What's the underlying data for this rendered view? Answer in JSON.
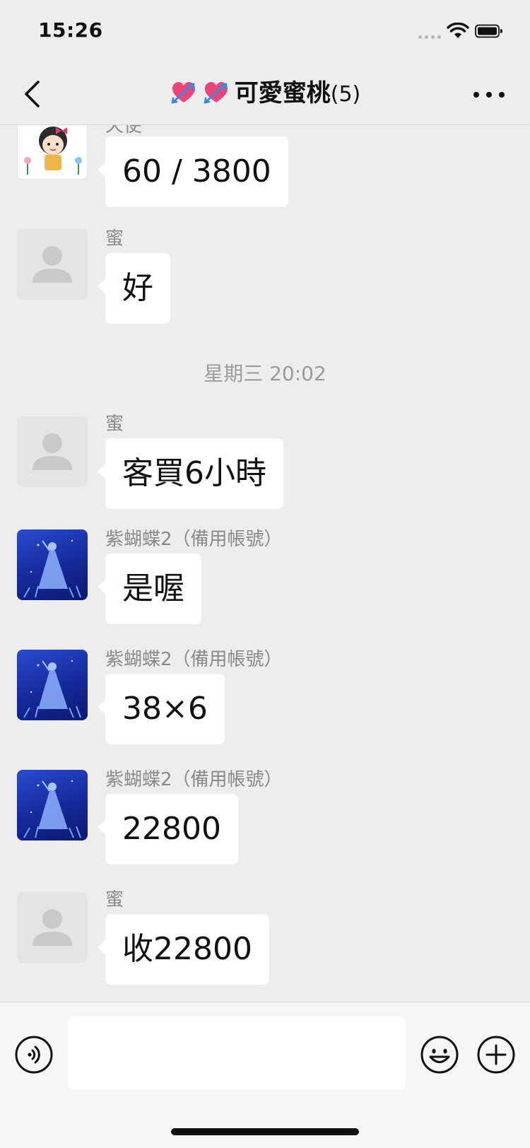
{
  "status_bar": {
    "time": "15:26"
  },
  "header": {
    "title": "可愛蜜桃",
    "member_count": "(5)",
    "title_emoji": "heart-with-arrow-icon"
  },
  "messages": [
    {
      "sender": "天使",
      "text": "60 / 3800",
      "avatar": "cartoon-girl"
    },
    {
      "sender": "蜜",
      "text": "好",
      "avatar": "default-person"
    },
    {
      "sender": "蜜",
      "text": "客買6小時",
      "avatar": "default-person"
    },
    {
      "sender": "紫蝴蝶2（備用帳號）",
      "text": "是喔",
      "avatar": "blue-dress-girl"
    },
    {
      "sender": "紫蝴蝶2（備用帳號）",
      "text": "38×6",
      "avatar": "blue-dress-girl"
    },
    {
      "sender": "紫蝴蝶2（備用帳號）",
      "text": "22800",
      "avatar": "blue-dress-girl"
    },
    {
      "sender": "蜜",
      "text": "收22800",
      "avatar": "default-person"
    }
  ],
  "timestamp": "星期三 20:02",
  "input": {
    "value": "",
    "placeholder": ""
  },
  "colors": {
    "chat_background": "#ededed",
    "bubble": "#ffffff",
    "sender_name": "#8a8a8a",
    "timestamp": "#9b9b9b",
    "input_bar": "#f6f6f6"
  }
}
